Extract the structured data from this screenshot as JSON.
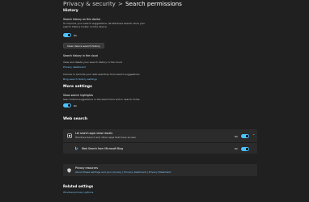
{
  "breadcrumb": {
    "parent": "Privacy & security",
    "separator": ">",
    "current": "Search permissions"
  },
  "history": {
    "heading": "History",
    "search_history_label": "Search history on this device",
    "search_history_desc": "To improve your search suggestions, let Windows Search store your search history locally on this device.",
    "toggle_state": "On",
    "clear_button": "Clear device search history",
    "cloud_heading": "Search history in the cloud",
    "cloud_desc": "View and delete your search history in the cloud",
    "privacy_dashboard_link": "Privacy dashboard",
    "include_exclude_desc": "Include or exclude your web searches from search suggestions",
    "bing_link": "Bing search history settings"
  },
  "more_settings": {
    "heading": "More settings",
    "highlights_label": "Show search highlights",
    "highlights_desc": "See content suggestions in the search box and in search home",
    "toggle_state": "On"
  },
  "web_search": {
    "heading": "Web search",
    "row1_label": "Let search apps show results",
    "row1_desc": "Windows Search and other apps that have access",
    "row1_state": "On",
    "row2_label": "Web Search from Microsoft Bing",
    "row2_state": "On"
  },
  "privacy_resources": {
    "title": "Privacy resources",
    "links": "About these settings and your privacy | Privacy dashboard | Privacy Statement"
  },
  "related": {
    "heading": "Related settings",
    "link": "Windows privacy options"
  },
  "colors": {
    "accent": "#4cc2ff",
    "background": "#202020",
    "card": "#2b2b2b",
    "link": "#7fc6f5"
  }
}
